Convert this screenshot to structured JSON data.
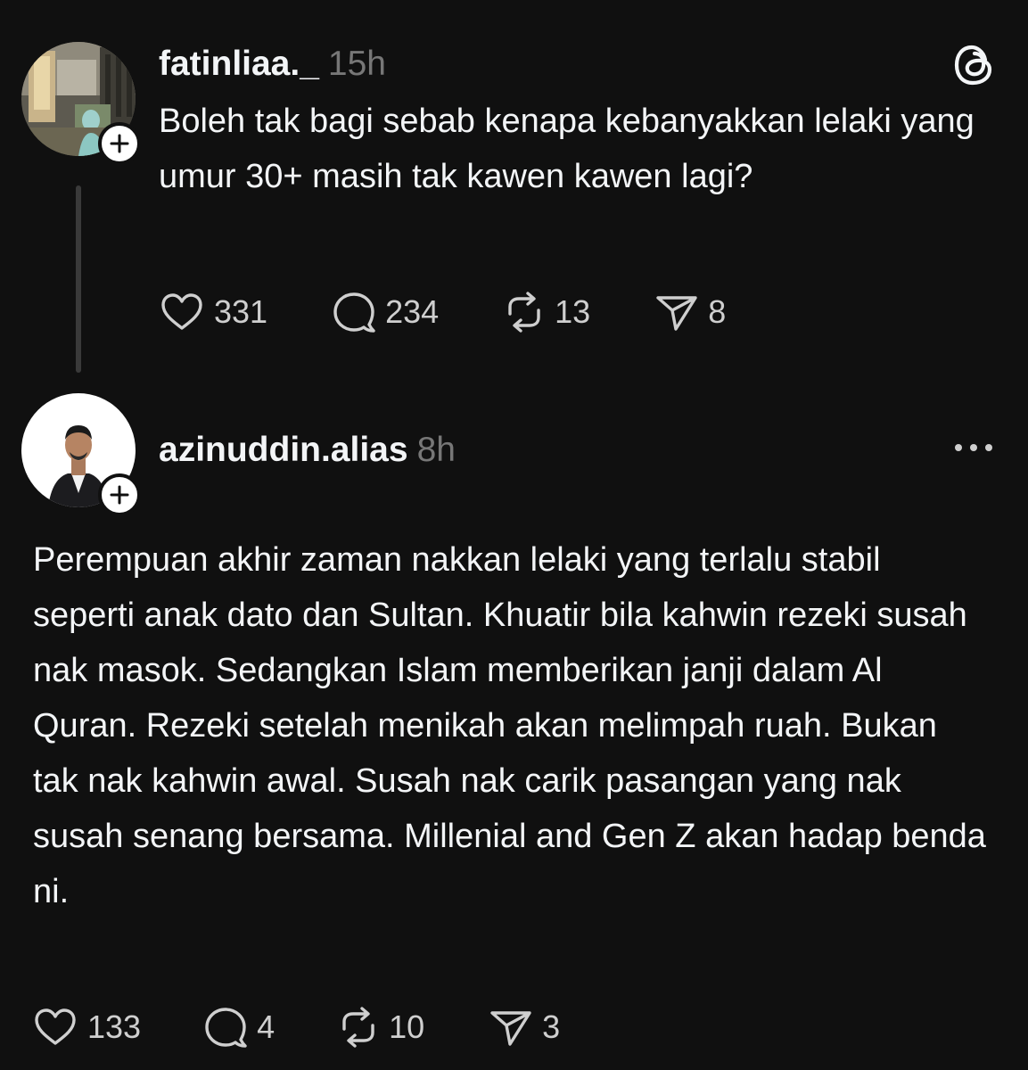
{
  "app": {
    "logo_icon": "threads-logo-icon",
    "more_icon": "more-options-icon"
  },
  "post": {
    "username": "fatinliaa._",
    "time": "15h",
    "text": "Boleh tak bagi sebab kenapa kebanyakkan lelaki yang umur 30+ masih tak kawen kawen lagi?",
    "actions": {
      "likes": "331",
      "replies": "234",
      "reposts": "13",
      "shares": "8"
    }
  },
  "reply": {
    "username": "azinuddin.alias",
    "time": "8h",
    "text": "Perempuan akhir zaman nakkan lelaki yang terlalu stabil seperti anak dato dan Sultan. Khuatir bila kahwin rezeki susah nak masok. Sedangkan Islam memberikan janji dalam Al Quran. Rezeki setelah menikah akan melimpah ruah. Bukan tak nak kahwin awal. Susah nak carik pasangan yang nak susah senang bersama. Millenial and Gen Z akan hadap benda ni.",
    "actions": {
      "likes": "133",
      "replies": "4",
      "reposts": "10",
      "shares": "3"
    }
  },
  "colors": {
    "background": "#101010",
    "text": "#f3f5f7",
    "muted": "#777777",
    "thread_line": "#3a3a3a"
  }
}
